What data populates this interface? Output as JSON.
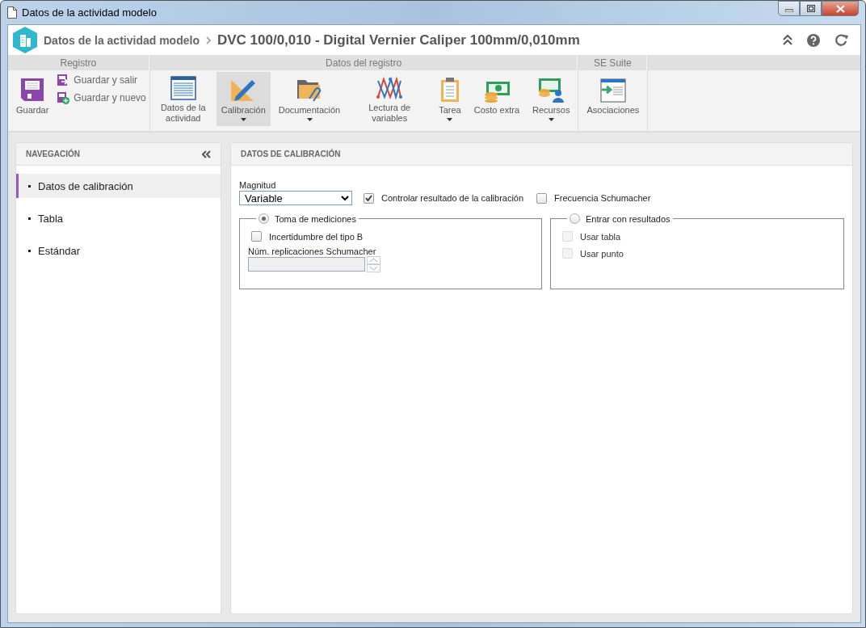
{
  "window": {
    "title": "Datos de la actividad modelo"
  },
  "header": {
    "title": "Datos de la actividad modelo",
    "record": "DVC 100/0,010 - Digital Vernier Caliper 100mm/0,010mm"
  },
  "ribbon": {
    "groups": [
      {
        "label": "Registro",
        "items": [
          {
            "label": "Guardar",
            "kind": "large",
            "dropdown": false,
            "selected": false
          },
          {
            "label": "Guardar y salir",
            "kind": "small",
            "selected": false
          },
          {
            "label": "Guardar y nuevo",
            "kind": "small",
            "selected": false
          }
        ]
      },
      {
        "label": "Datos del registro",
        "items": [
          {
            "label": "Datos de la actividad",
            "kind": "large",
            "dropdown": false,
            "selected": false
          },
          {
            "label": "Calibración",
            "kind": "large",
            "dropdown": true,
            "selected": true
          },
          {
            "label": "Documentación",
            "kind": "large",
            "dropdown": true,
            "selected": false
          },
          {
            "label": "Lectura de variables",
            "kind": "large",
            "dropdown": false,
            "selected": false
          },
          {
            "label": "Tarea",
            "kind": "large",
            "dropdown": true,
            "selected": false
          },
          {
            "label": "Costo extra",
            "kind": "large",
            "dropdown": false,
            "selected": false
          },
          {
            "label": "Recursos",
            "kind": "large",
            "dropdown": true,
            "selected": false
          }
        ]
      },
      {
        "label": "SE Suite",
        "items": [
          {
            "label": "Asociaciones",
            "kind": "large",
            "dropdown": false,
            "selected": false
          }
        ]
      }
    ]
  },
  "navigation": {
    "title": "NAVEGACIÓN",
    "items": [
      {
        "label": "Datos de calibración",
        "selected": true
      },
      {
        "label": "Tabla",
        "selected": false
      },
      {
        "label": "Estándar",
        "selected": false
      }
    ]
  },
  "form": {
    "title": "DATOS DE CALIBRACIÓN",
    "magnitude": {
      "label": "Magnitud",
      "value": "Variable"
    },
    "checks": [
      {
        "label": "Controlar resultado de la calibración",
        "checked": true
      },
      {
        "label": "Frecuencia Schumacher",
        "checked": false
      }
    ],
    "groups": [
      {
        "label": "Toma de mediciones",
        "selected": true,
        "options": [
          {
            "label": "Incertidumbre del tipo B",
            "checked": false,
            "disabled": false
          }
        ],
        "field": {
          "label": "Núm. replicaciones Schumacher",
          "disabled": true
        }
      },
      {
        "label": "Entrar con resultados",
        "selected": false,
        "options": [
          {
            "label": "Usar tabla",
            "checked": false,
            "disabled": true
          },
          {
            "label": "Usar punto",
            "checked": false,
            "disabled": true
          }
        ]
      }
    ]
  }
}
